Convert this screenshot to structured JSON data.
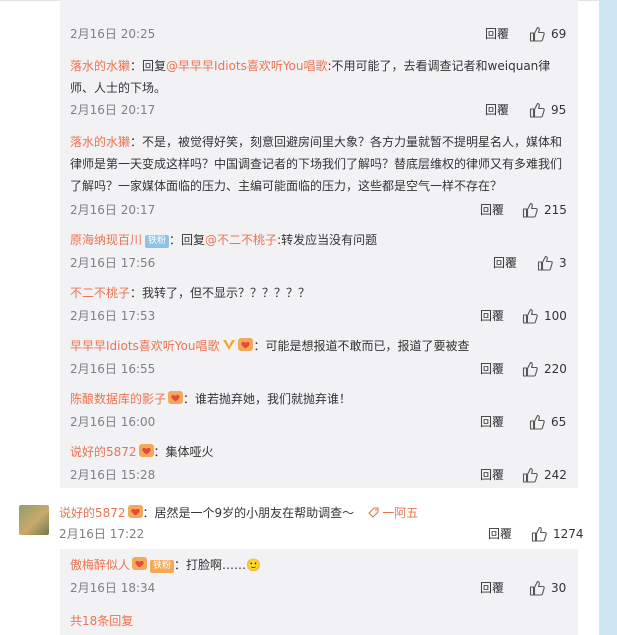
{
  "replies": [
    {
      "author": "",
      "badge": "",
      "lead": "",
      "mention": "",
      "content": "",
      "time": "2月16日 20:25",
      "reply_label": "回覆",
      "likes": "69"
    },
    {
      "author": "落水的水獭",
      "lead": "：回复",
      "mention": "@早早早Idiots喜欢听You唱歌",
      "content": ":不用可能了，去看调查记者和weiquan律师、人士的下场。",
      "time": "2月16日 20:17",
      "reply_label": "回覆",
      "likes": "95"
    },
    {
      "author": "落水的水獭",
      "lead": "：不是，被觉得好笑，刻意回避房间里大象？各方力量就暂不提明星名人，媒体和律师是第一天变成这样吗？中国调查记者的下场我们了解吗？替底层维权的律师又有多难我们了解吗？一家媒体面临的压力、主编可能面临的压力，这些都是空气一样不存在？",
      "time": "2月16日 20:17",
      "reply_label": "回覆",
      "likes": "215"
    },
    {
      "author": "原海纳现百川",
      "badge": "铁粉",
      "lead": "：回复",
      "mention": "@不二不桃子",
      "content": ":转发应当没有问题",
      "time": "2月16日 17:56",
      "reply_label": "回覆",
      "likes": "3"
    },
    {
      "author": "不二不桃子",
      "lead": "：我转了，但不显示？？？？？？",
      "time": "2月16日 17:53",
      "reply_label": "回覆",
      "likes": "100"
    },
    {
      "author": "早早早Idiots喜欢听You唱歌",
      "lead": "：可能是想报道不敢而已，报道了要被查",
      "time": "2月16日 16:55",
      "reply_label": "回覆",
      "likes": "220"
    },
    {
      "author": "陈酿数据库的影子",
      "lead": "：谁若抛弃她，我们就抛弃谁！",
      "time": "2月16日 16:00",
      "reply_label": "回覆",
      "likes": "65"
    },
    {
      "author": "说好的5872",
      "lead": "：集体哑火",
      "time": "2月16日 15:28",
      "reply_label": "回覆",
      "likes": "242"
    }
  ],
  "main_comment": {
    "author": "说好的5872",
    "lead": "：居然是一个9岁的小朋友在帮助调查～",
    "tag": "一阿五",
    "time": "2月16日 17:22",
    "reply_label": "回覆",
    "likes": "1274"
  },
  "sub_reply": {
    "author": "傲梅醉似人",
    "badge": "铁粉",
    "lead": "：打脸啊……🙂",
    "time": "2月16日 18:34",
    "reply_label": "回覆",
    "likes": "30"
  },
  "more_replies": "共18条回复",
  "colors": {
    "accent": "#eb7350",
    "reply_bg": "#f2f2f5",
    "strip": "#cfe6f5"
  },
  "icons": [
    "thumb-up-icon",
    "verified-v-icon",
    "heart-badge-icon",
    "tag-icon"
  ]
}
